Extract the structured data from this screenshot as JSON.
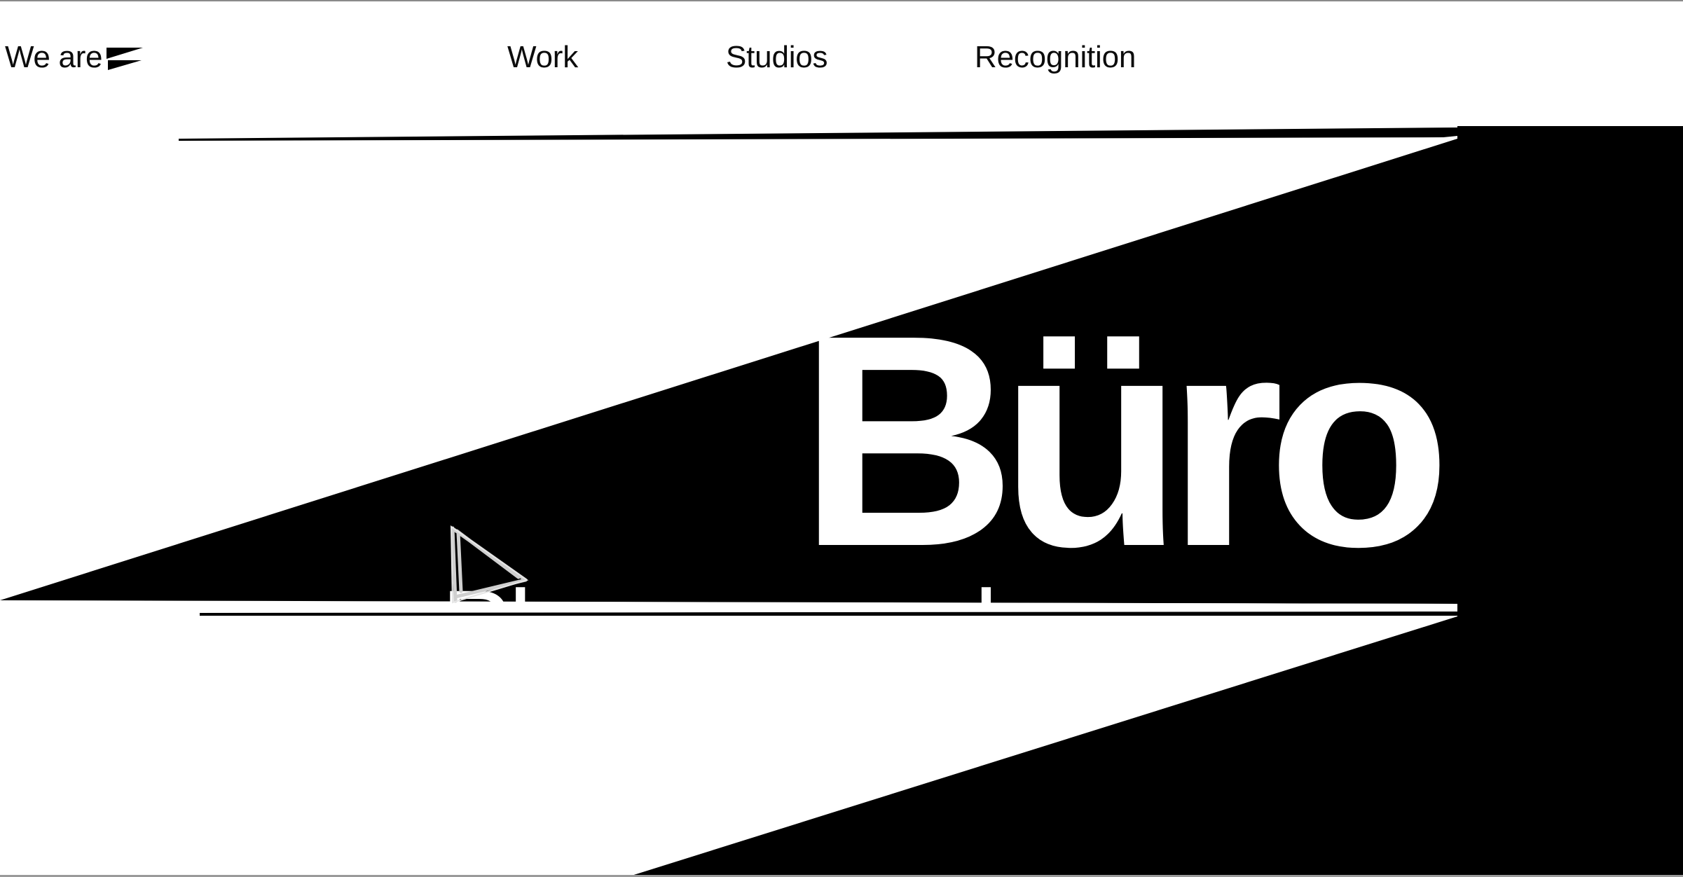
{
  "header": {
    "brand": {
      "text": "We are",
      "icon": "buro-flag-icon"
    },
    "nav": {
      "work": "Work",
      "studios": "Studios",
      "recognition": "Recognition"
    }
  },
  "hero": {
    "title": "Büro",
    "reel_button": {
      "icon": "play-triangle-icon",
      "label": "Play our reel"
    }
  },
  "colors": {
    "background": "#ffffff",
    "foreground": "#000000",
    "text": "#0c0c0c"
  }
}
